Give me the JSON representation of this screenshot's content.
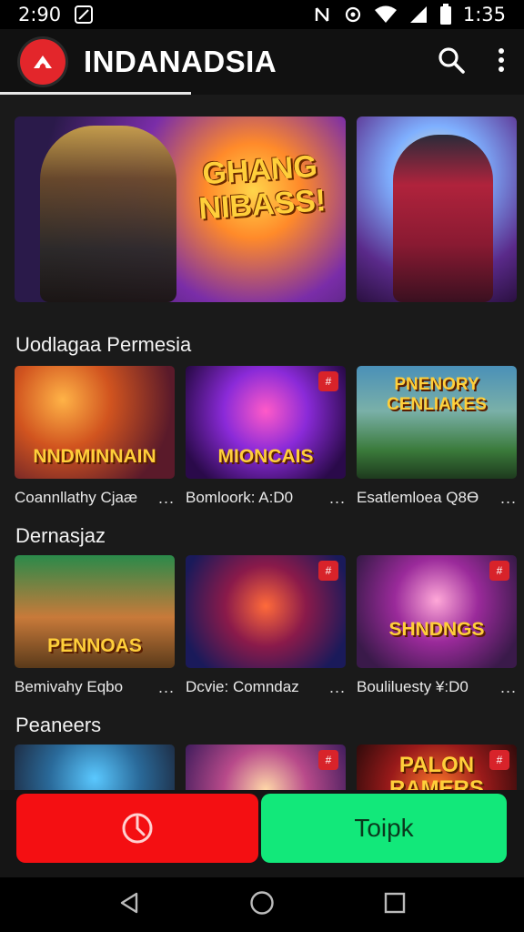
{
  "status_bar": {
    "time": "2:90",
    "right_time": "1:35"
  },
  "app_bar": {
    "title": "INDANADSIA"
  },
  "hero": {
    "main_title": "GHANG NIBASS!"
  },
  "sections": [
    {
      "title": "Uodlagaa Permesia",
      "tiles": [
        {
          "caption": "Coannllathy Cjaæ",
          "art_text": "NNDMINNAIN",
          "more": "..."
        },
        {
          "caption": "Bomloork: A:D0",
          "art_text": "MIONCAIS",
          "more": "..."
        },
        {
          "caption": "Esatlemloea Q8Ө",
          "art_text": "PNENORY CENLIAKES",
          "more": "..."
        }
      ]
    },
    {
      "title": "Dernasjaz",
      "tiles": [
        {
          "caption": "Bemivahy Eqbo",
          "art_text": "PENNOAS",
          "more": "..."
        },
        {
          "caption": "Dcvie: Comndaz",
          "art_text": "",
          "more": "..."
        },
        {
          "caption": "Bouliluesty ¥:D0",
          "art_text": "SHNDNGS",
          "more": "..."
        }
      ]
    },
    {
      "title": "Peaneers",
      "tiles": [
        {
          "art_text": ""
        },
        {
          "art_text": ""
        },
        {
          "art_text": "PALON RAMERS"
        }
      ]
    }
  ],
  "buttons": {
    "secondary_label": "Toipk",
    "primary_icon": "timer-icon"
  },
  "colors": {
    "primary_red": "#f40f12",
    "action_green": "#12e87a",
    "logo_red": "#e3262b"
  }
}
